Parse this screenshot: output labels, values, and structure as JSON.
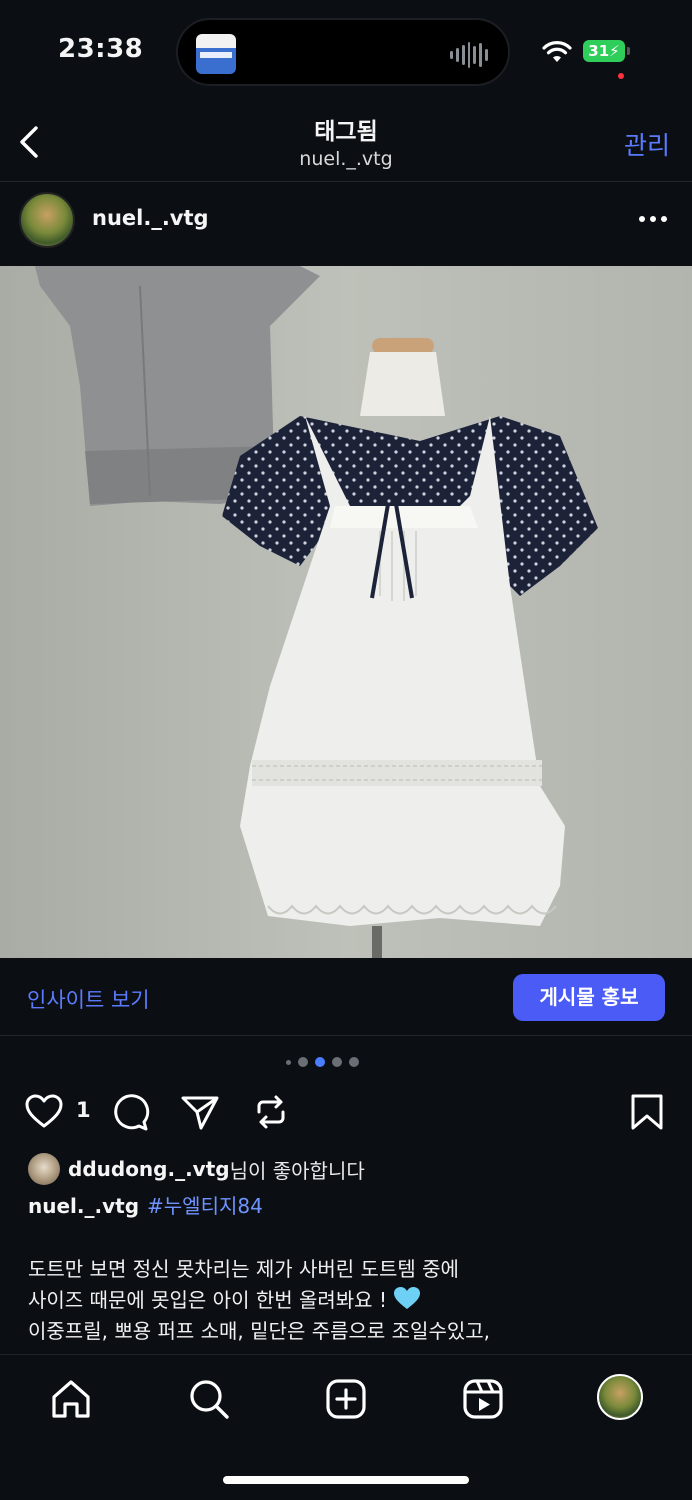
{
  "status_bar": {
    "time": "23:38",
    "battery": "31"
  },
  "header": {
    "title": "태그됨",
    "subtitle": "nuel._.vtg",
    "manage_label": "관리"
  },
  "post": {
    "username": "nuel._.vtg",
    "insight_label": "인사이트 보기",
    "promote_label": "게시물 홍보",
    "carousel": {
      "total_dots": 5,
      "active_index": 2
    },
    "like_count": "1",
    "liked_by_user": "ddudong._.vtg",
    "liked_by_suffix": "님이 좋아합니다",
    "caption_user": "nuel._.vtg",
    "caption_hashtag": "#누엘티지84",
    "caption_lines": [
      "도트만 보면 정신 못차리는 제가 사버린 도트템 중에",
      "사이즈 때문에 못입은 아이 한번 올려봐요 !",
      "이중프릴, 뽀용 퍼프 소매, 밑단은 주름으로 조일수있고,"
    ]
  },
  "icons": {
    "back": "chevron-left-icon",
    "more": "more-horizontal-icon",
    "like": "heart-outline-icon",
    "comment": "comment-icon",
    "share": "send-icon",
    "repost": "repost-icon",
    "save": "bookmark-icon",
    "home": "home-icon",
    "search": "search-icon",
    "create": "plus-square-icon",
    "reels": "reels-icon"
  },
  "colors": {
    "accent": "#5b7bff",
    "button": "#4a5cf5",
    "background": "#0b0f14",
    "battery": "#2fcd5a"
  }
}
